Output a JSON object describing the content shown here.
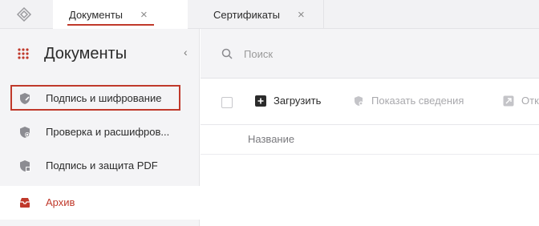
{
  "tabs": [
    {
      "label": "Документы",
      "active": true
    },
    {
      "label": "Сертификаты",
      "active": false
    }
  ],
  "tab_close_glyph": "×",
  "sidebar": {
    "title": "Документы",
    "collapse_glyph": "‹",
    "items": [
      {
        "label": "Подпись и шифрование",
        "icon": "shield-sign-icon",
        "selected": true
      },
      {
        "label": "Проверка и расшифров...",
        "icon": "shield-verify-icon"
      },
      {
        "label": "Подпись и защита PDF",
        "icon": "shield-pdf-icon"
      },
      {
        "label": "Архив",
        "icon": "archive-icon",
        "accent": true
      }
    ]
  },
  "search": {
    "placeholder": "Поиск",
    "value": ""
  },
  "toolbar": {
    "upload_label": "Загрузить",
    "details_label": "Показать сведения",
    "other_label": "Отк"
  },
  "table": {
    "columns": [
      "Название"
    ]
  },
  "colors": {
    "accent": "#c0392b",
    "sidebar_bg": "#f4f4f6",
    "text": "#2b2b2b",
    "muted": "#a9a9ad"
  }
}
